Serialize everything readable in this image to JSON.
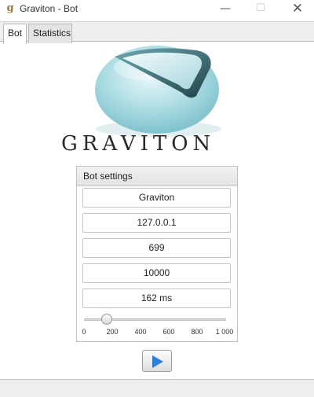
{
  "window": {
    "title": "Graviton - Bot",
    "icon": "g",
    "controls": {
      "minimize": "—",
      "maximize": "☐",
      "close": "✕"
    }
  },
  "tabs": [
    {
      "label": "Bot",
      "selected": true
    },
    {
      "label": "Statistics",
      "selected": false
    }
  ],
  "logo": {
    "text": "GRAVITON",
    "colors": {
      "sphere": "#a9dde4",
      "ring": "#2f5e66"
    }
  },
  "settings": {
    "header": "Bot settings",
    "fields": [
      "Graviton",
      "127.0.0.1",
      "699",
      "10000",
      "162 ms"
    ],
    "slider": {
      "value": 162,
      "min": 0,
      "max": 1000,
      "ticks": [
        "0",
        "200",
        "400",
        "600",
        "800",
        "1 000"
      ]
    }
  },
  "play_button": {
    "icon": "play-icon",
    "color": "#2f7ed8"
  }
}
